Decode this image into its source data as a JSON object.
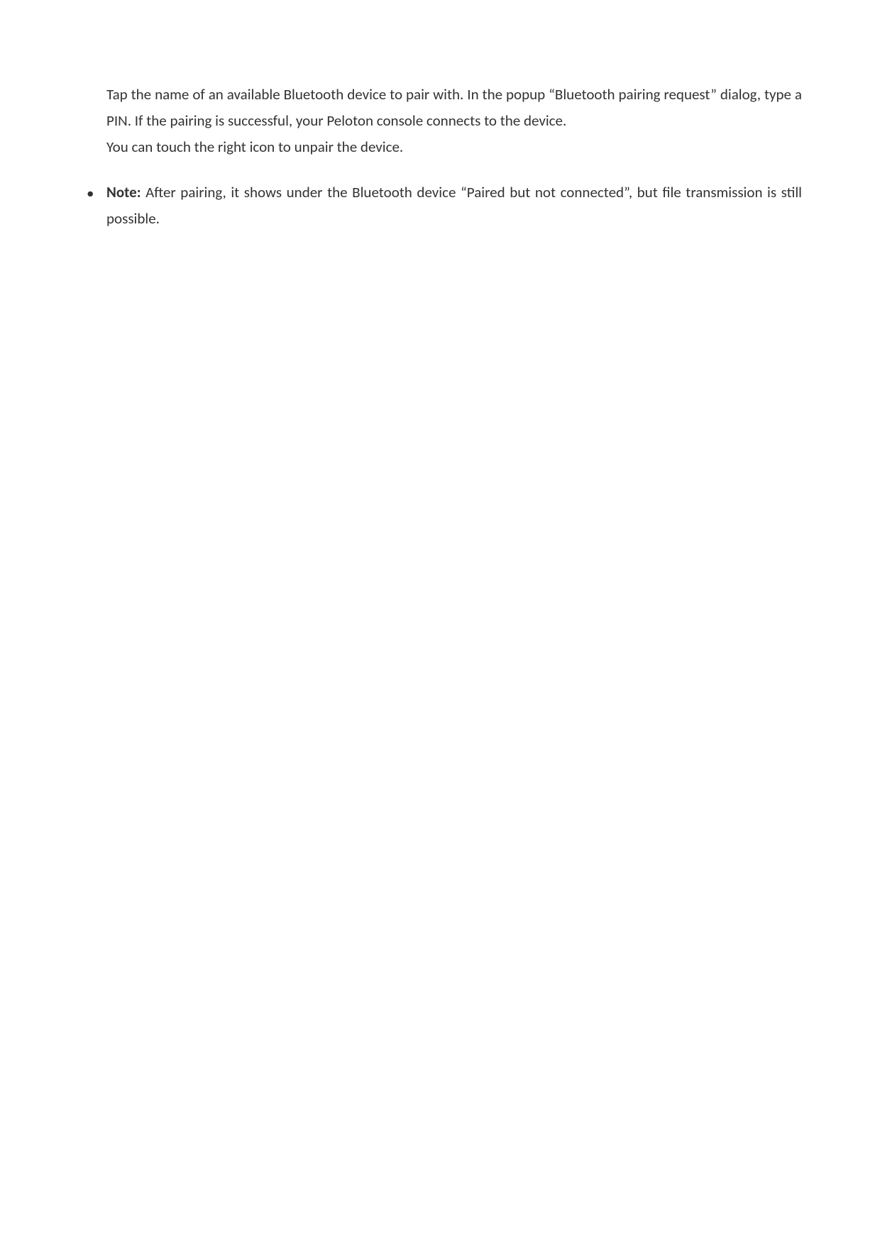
{
  "content": {
    "paragraph1": "Tap the name of an available Bluetooth device to pair with. In the popup “Bluetooth pairing request” dialog, type a PIN. If the pairing is successful, your Peloton console connects to the device.",
    "paragraph2": "You can touch the right icon to unpair the device.",
    "bullet_marker": "•",
    "note_label": "Note:",
    "note_text": " After pairing, it shows under the Bluetooth device “Paired but not connected”, but file transmission is still possible."
  }
}
